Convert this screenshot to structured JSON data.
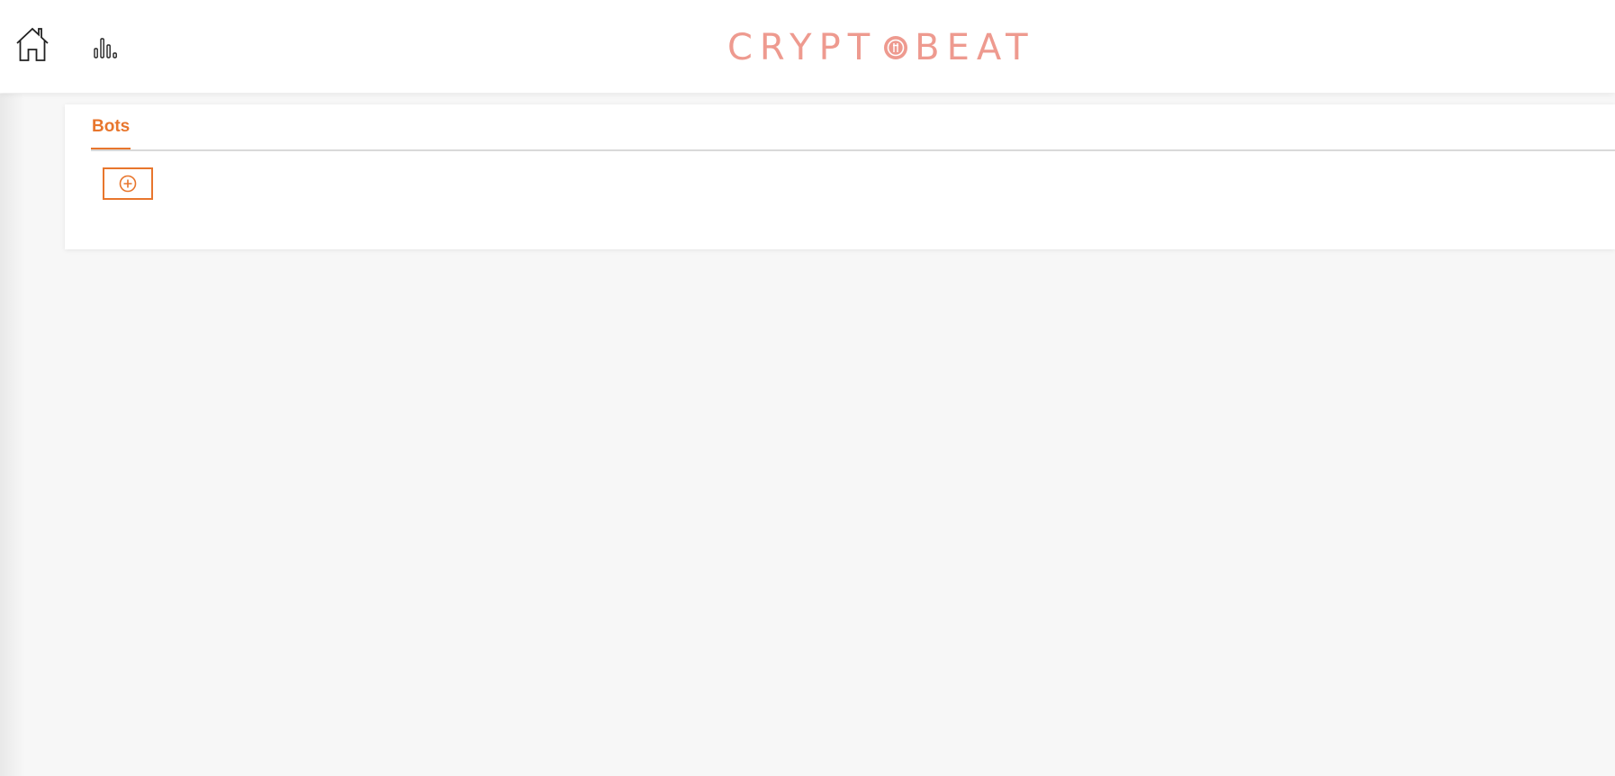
{
  "header": {
    "home_icon": "home-icon",
    "stats_icon": "bar-chart-icon",
    "logo": {
      "text_left": "CRYPT",
      "text_right": "BEAT",
      "coin_icon": "coin-icon",
      "color": "#ee9a8f"
    }
  },
  "main": {
    "tabs": [
      {
        "label": "Bots",
        "active": true
      }
    ],
    "add_button": {
      "icon": "add-circle-icon"
    }
  },
  "colors": {
    "accent": "#e8762d",
    "background": "#f7f7f7",
    "surface": "#ffffff"
  }
}
